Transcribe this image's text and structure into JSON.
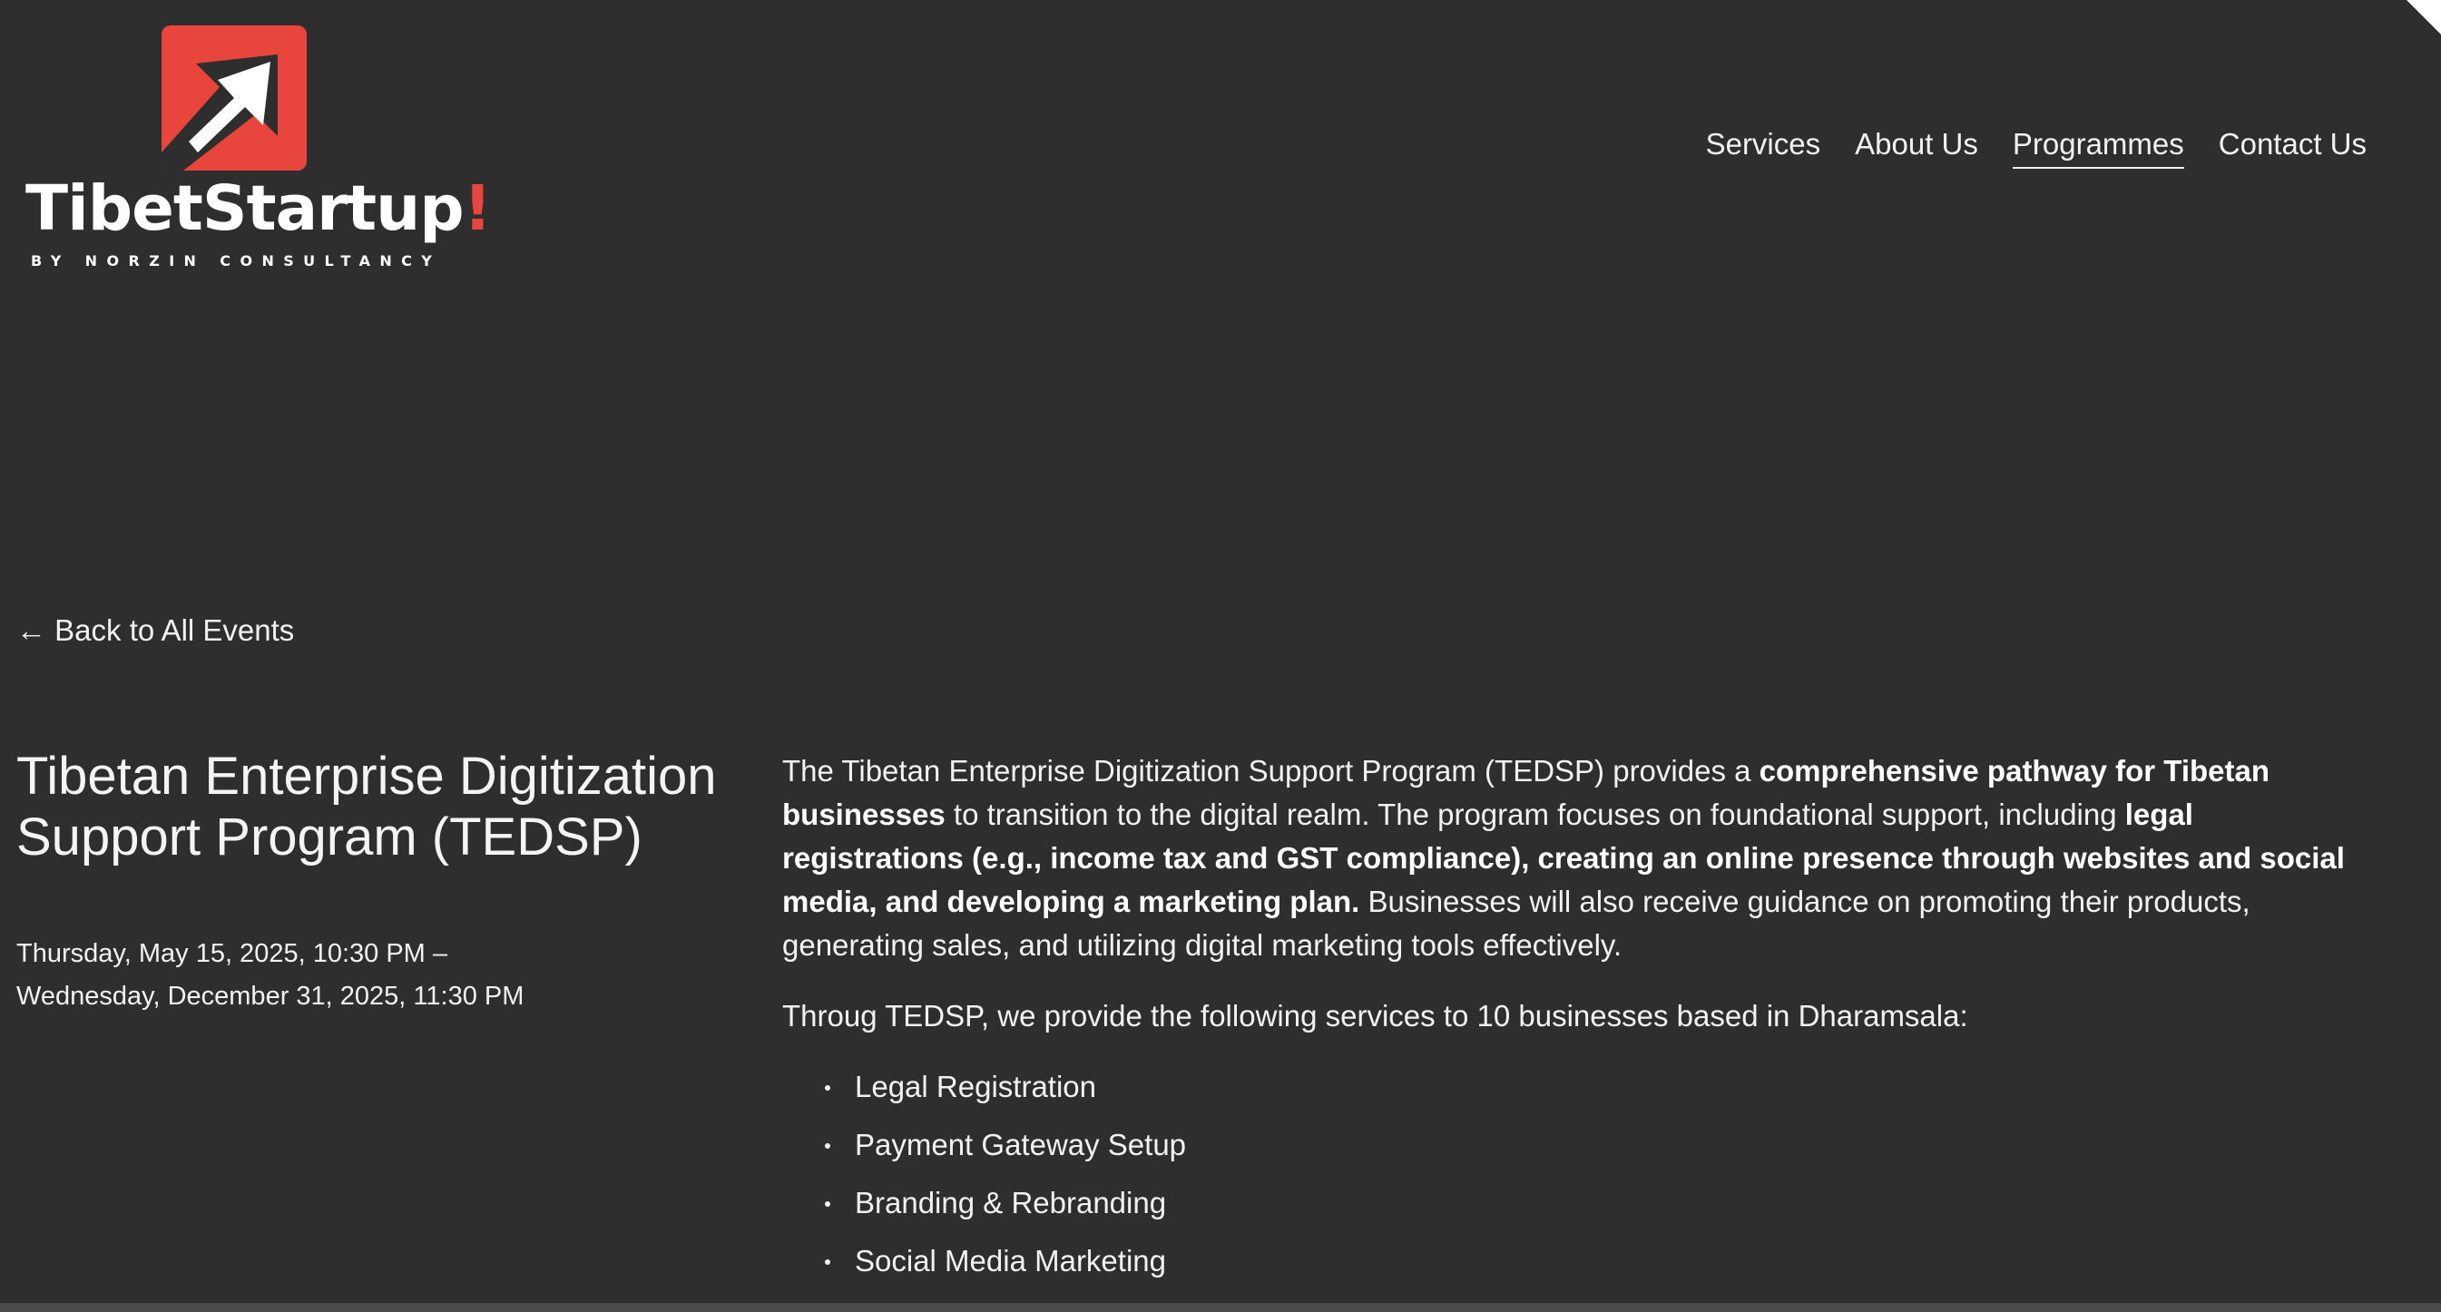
{
  "brand": {
    "name": "TibetStartup",
    "name_bang": "!",
    "tagline": "BY NORZIN CONSULTANCY",
    "accent_color": "#e8453c"
  },
  "nav": {
    "items": [
      {
        "label": "Services"
      },
      {
        "label": "About Us"
      },
      {
        "label": "Programmes",
        "active": true
      },
      {
        "label": "Contact Us"
      }
    ]
  },
  "back_link": {
    "arrow": "←",
    "label": "Back to All Events"
  },
  "event": {
    "title": "Tibetan Enterprise Digitization Support Program (TEDSP)",
    "start": "Thursday, May 15, 2025, 10:30 PM –",
    "end": "Wednesday, December 31, 2025, 11:30 PM"
  },
  "description": {
    "p1_a": "The Tibetan Enterprise Digitization Support Program (TEDSP) provides a ",
    "p1_b": "comprehensive pathway for Tibetan businesses",
    "p1_c": " to transition to the digital realm. The program focuses on foundational support, including ",
    "p1_d": "legal registrations (e.g., income tax and GST compliance), creating an online presence through websites and social media, and developing a marketing plan.",
    "p1_e": " Businesses will also receive guidance on promoting their products, generating sales, and utilizing digital marketing tools effectively.",
    "p2": "Throug TEDSP, we provide the following services to 10 businesses based in Dharamsala:",
    "services": [
      "Legal Registration",
      "Payment Gateway Setup",
      "Branding & Rebranding",
      "Social Media Marketing"
    ]
  }
}
